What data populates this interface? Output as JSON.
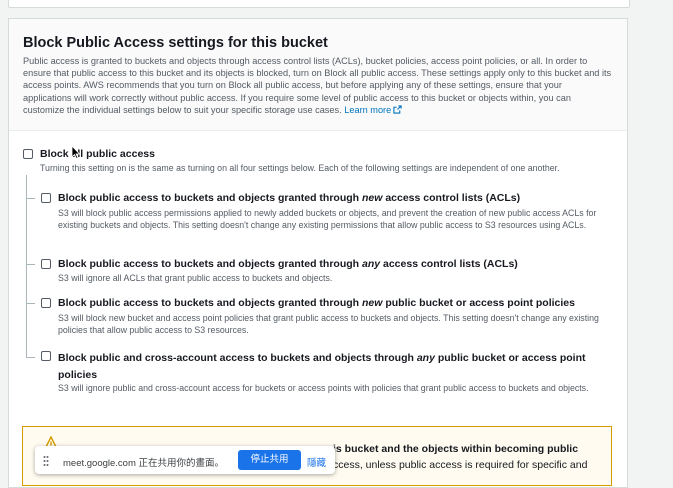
{
  "section": {
    "title": "Block Public Access settings for this bucket",
    "description": "Public access is granted to buckets and objects through access control lists (ACLs), bucket policies, access point policies, or all. In order to ensure that public access to this bucket and its objects is blocked, turn on Block all public access. These settings apply only to this bucket and its access points. AWS recommends that you turn on Block all public access, but before applying any of these settings, ensure that your applications will work correctly without public access. If you require some level of public access to this bucket or objects within, you can customize the individual settings below to suit your specific storage use cases.",
    "learn_more": "Learn more"
  },
  "block_all": {
    "label": "Block all public access",
    "description": "Turning this setting on is the same as turning on all four settings below. Each of the following settings are independent of one another.",
    "checked": false
  },
  "options": [
    {
      "label_pre": "Block public access to buckets and objects granted through ",
      "label_em": "new",
      "label_post": " access control lists (ACLs)",
      "description": "S3 will block public access permissions applied to newly added buckets or objects, and prevent the creation of new public access ACLs for existing buckets and objects. This setting doesn't change any existing permissions that allow public access to S3 resources using ACLs.",
      "checked": false
    },
    {
      "label_pre": "Block public access to buckets and objects granted through ",
      "label_em": "any",
      "label_post": " access control lists (ACLs)",
      "description": "S3 will ignore all ACLs that grant public access to buckets and objects.",
      "checked": false
    },
    {
      "label_pre": "Block public access to buckets and objects granted through ",
      "label_em": "new",
      "label_post": " public bucket or access point policies",
      "description": "S3 will block new bucket and access point policies that grant public access to buckets and objects. This setting doesn't change any existing policies that allow public access to S3 resources.",
      "checked": false
    },
    {
      "label_pre": "Block public and cross-account access to buckets and objects through ",
      "label_em": "any",
      "label_post": " public bucket or access point policies",
      "description": "S3 will ignore public and cross-account access for buckets or access points with policies that grant public access to buckets and objects.",
      "checked": false
    }
  ],
  "warning": {
    "line1": "is bucket and the objects within becoming public",
    "line2": "ccess, unless public access is required for specific and"
  },
  "share_bar": {
    "text": "meet.google.com 正在共用你的畫面。",
    "stop_label": "停止共用",
    "hide_label": "隱藏"
  },
  "colors": {
    "link": "#0073bb",
    "warning_border": "#d59b00",
    "meet_blue": "#1a73e8"
  }
}
